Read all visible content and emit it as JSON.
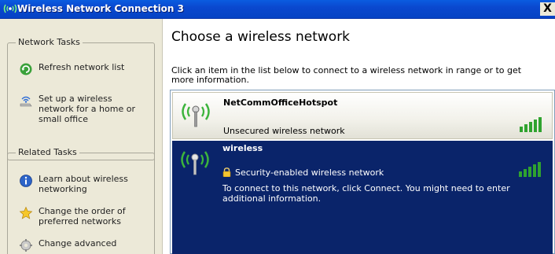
{
  "window": {
    "title": "Wireless Network Connection 3",
    "close_label": "X"
  },
  "network_tasks": {
    "title": "Network Tasks",
    "items": [
      {
        "label": "Refresh network list",
        "icon": "refresh-icon"
      },
      {
        "label": "Set up a wireless network for a home or small office",
        "icon": "setup-wireless-icon"
      }
    ]
  },
  "related_tasks": {
    "title": "Related Tasks",
    "items": [
      {
        "label": "Learn about wireless networking",
        "icon": "info-icon"
      },
      {
        "label": "Change the order of preferred networks",
        "icon": "star-icon"
      },
      {
        "label": "Change advanced",
        "icon": "settings-icon"
      }
    ]
  },
  "main": {
    "heading": "Choose a wireless network",
    "instructions": "Click an item in the list below to connect to a wireless network in range or to get more information."
  },
  "networks": [
    {
      "name": "NetCommOfficeHotspot",
      "status": "Unsecured wireless network",
      "signal_bars": 5,
      "selected": false
    },
    {
      "name": "wireless",
      "status": "Security-enabled wireless network",
      "detail": "To connect to this network, click Connect. You might need to enter additional information.",
      "signal_bars": 5,
      "selected": true
    }
  ],
  "colors": {
    "title_bar": "#0543c4",
    "selection": "#0a246a",
    "task_pane": "#ece9d8",
    "signal": "#2fa32f"
  }
}
